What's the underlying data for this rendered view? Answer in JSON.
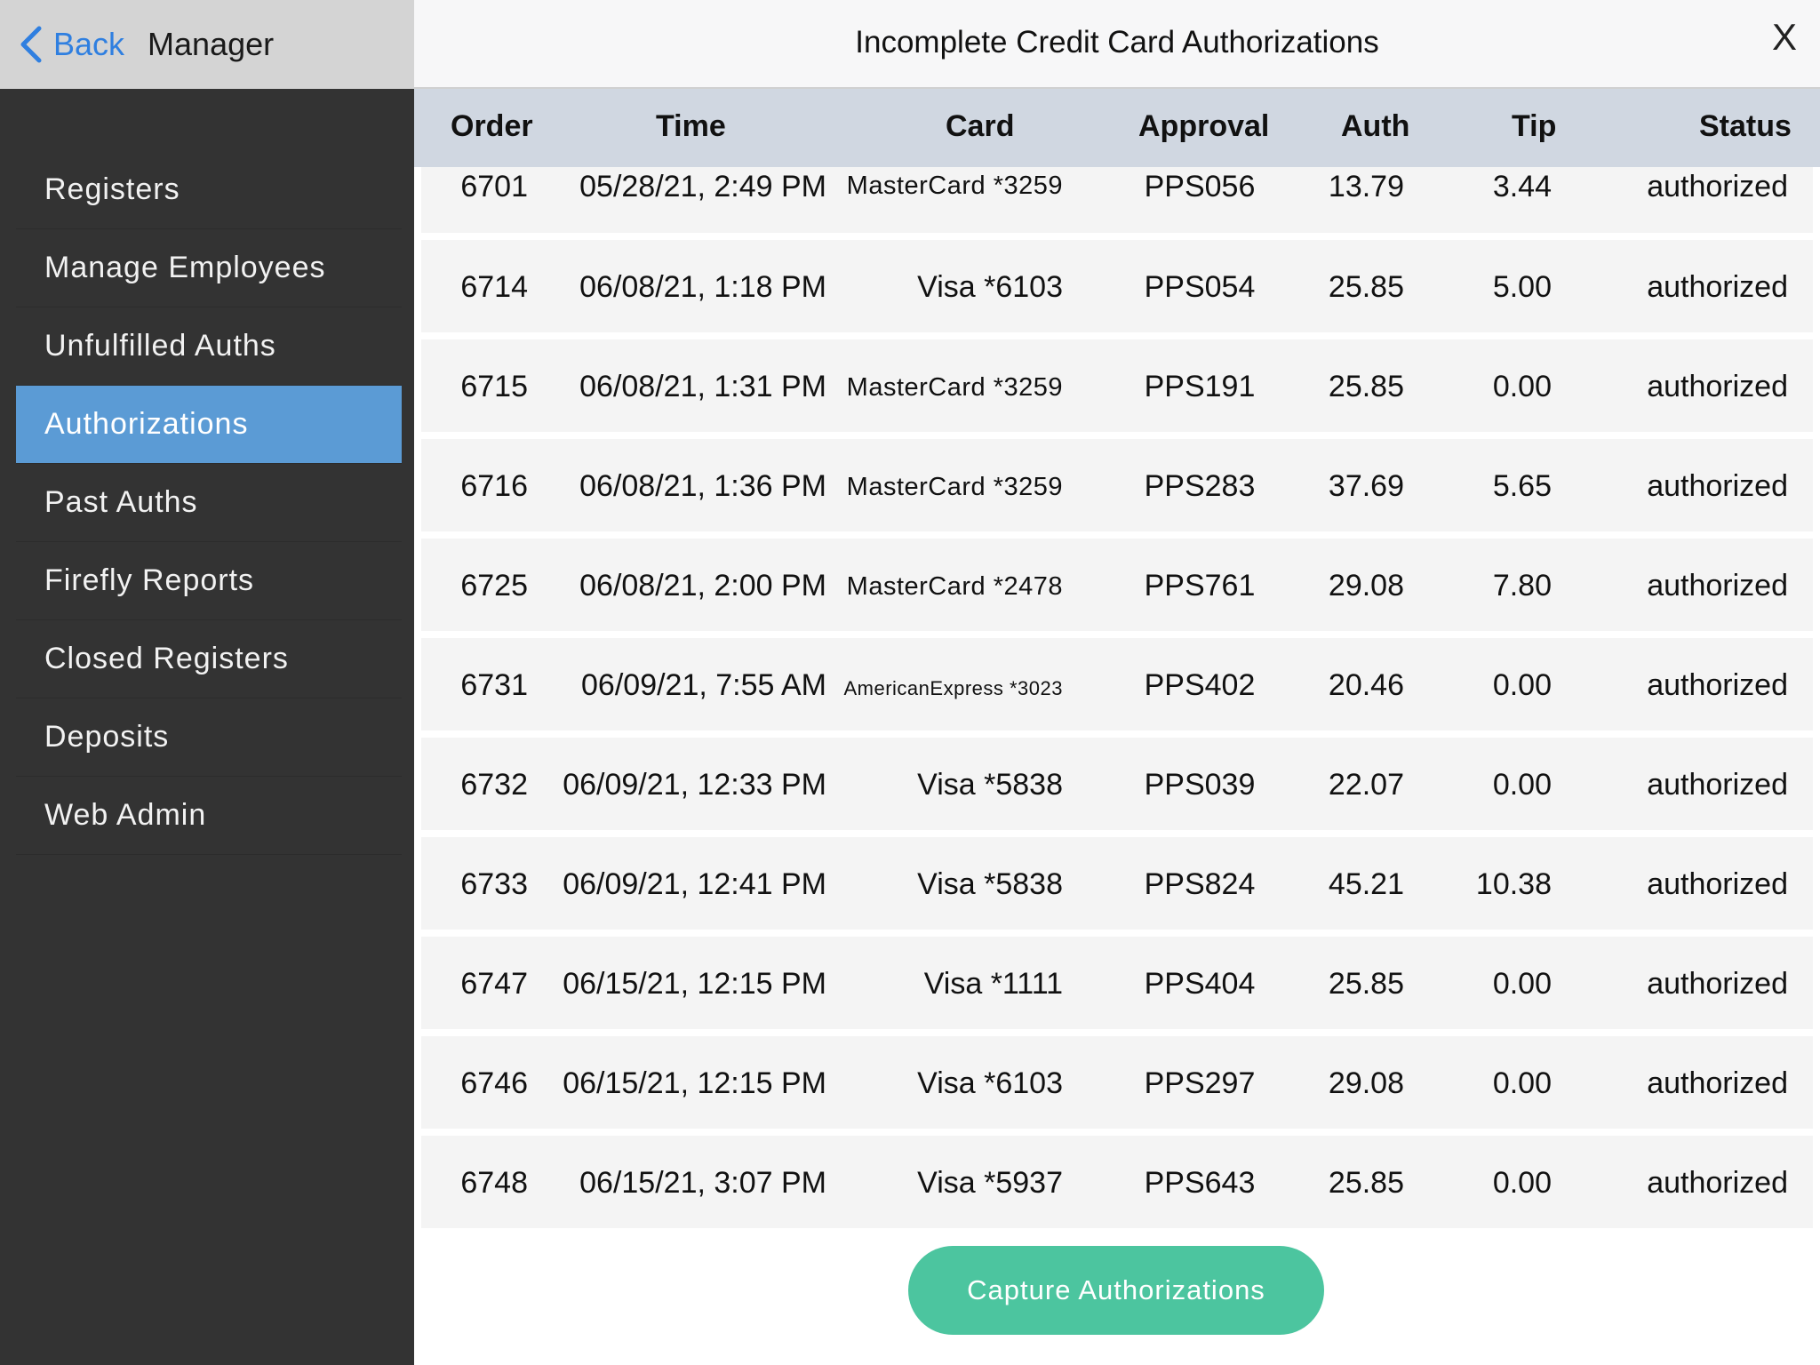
{
  "sidebar": {
    "back_label": "Back",
    "title": "Manager",
    "items": [
      {
        "label": "Registers"
      },
      {
        "label": "Manage Employees"
      },
      {
        "label": "Unfulfilled Auths"
      },
      {
        "label": "Authorizations",
        "active": true
      },
      {
        "label": "Past Auths"
      },
      {
        "label": "Firefly Reports"
      },
      {
        "label": "Closed Registers"
      },
      {
        "label": "Deposits"
      },
      {
        "label": "Web Admin"
      }
    ]
  },
  "main": {
    "title": "Incomplete Credit Card Authorizations",
    "close_label": "X",
    "columns": [
      "Order",
      "Time",
      "Card",
      "Approval",
      "Auth",
      "Tip",
      "Status"
    ],
    "rows": [
      {
        "order": "6701",
        "time": "05/28/21, 2:49 PM",
        "card": "MasterCard *3259",
        "approval": "PPS056",
        "auth": "13.79",
        "tip": "3.44",
        "status": "authorized"
      },
      {
        "order": "6714",
        "time": "06/08/21, 1:18 PM",
        "card": "Visa *6103",
        "approval": "PPS054",
        "auth": "25.85",
        "tip": "5.00",
        "status": "authorized"
      },
      {
        "order": "6715",
        "time": "06/08/21, 1:31 PM",
        "card": "MasterCard *3259",
        "approval": "PPS191",
        "auth": "25.85",
        "tip": "0.00",
        "status": "authorized"
      },
      {
        "order": "6716",
        "time": "06/08/21, 1:36 PM",
        "card": "MasterCard *3259",
        "approval": "PPS283",
        "auth": "37.69",
        "tip": "5.65",
        "status": "authorized"
      },
      {
        "order": "6725",
        "time": "06/08/21, 2:00 PM",
        "card": "MasterCard *2478",
        "approval": "PPS761",
        "auth": "29.08",
        "tip": "7.80",
        "status": "authorized"
      },
      {
        "order": "6731",
        "time": "06/09/21, 7:55 AM",
        "card": "AmericanExpress *3023",
        "approval": "PPS402",
        "auth": "20.46",
        "tip": "0.00",
        "status": "authorized"
      },
      {
        "order": "6732",
        "time": "06/09/21, 12:33 PM",
        "card": "Visa *5838",
        "approval": "PPS039",
        "auth": "22.07",
        "tip": "0.00",
        "status": "authorized"
      },
      {
        "order": "6733",
        "time": "06/09/21, 12:41 PM",
        "card": "Visa *5838",
        "approval": "PPS824",
        "auth": "45.21",
        "tip": "10.38",
        "status": "authorized"
      },
      {
        "order": "6747",
        "time": "06/15/21, 12:15 PM",
        "card": "Visa *1111",
        "approval": "PPS404",
        "auth": "25.85",
        "tip": "0.00",
        "status": "authorized"
      },
      {
        "order": "6746",
        "time": "06/15/21, 12:15 PM",
        "card": "Visa *6103",
        "approval": "PPS297",
        "auth": "29.08",
        "tip": "0.00",
        "status": "authorized"
      },
      {
        "order": "6748",
        "time": "06/15/21, 3:07 PM",
        "card": "Visa *5937",
        "approval": "PPS643",
        "auth": "25.85",
        "tip": "0.00",
        "status": "authorized"
      }
    ],
    "capture_label": "Capture Authorizations"
  },
  "colors": {
    "sidebar_bg": "#333333",
    "active_item": "#5b9bd5",
    "back_link": "#2f7fe0",
    "table_header": "#d0d7e1",
    "row_bg": "#f4f4f4",
    "capture_button": "#4cc59f"
  },
  "icons": {
    "back": "chevron-left-icon"
  }
}
